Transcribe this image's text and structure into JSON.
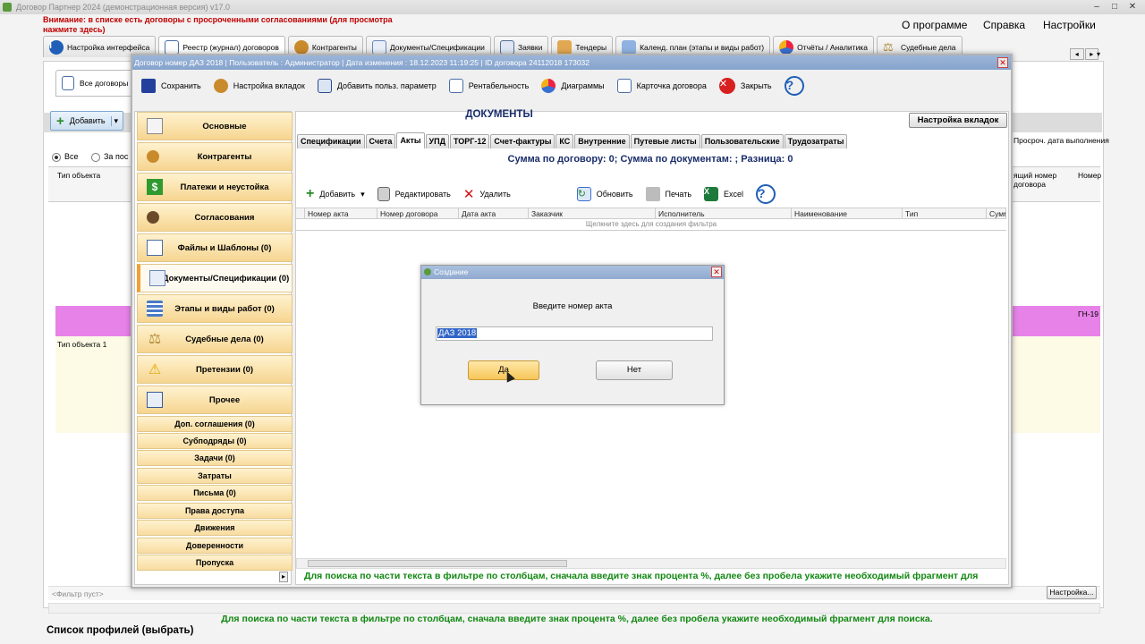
{
  "app": {
    "title": "Договор Партнер 2024 (демонстрационная версия) v17.0",
    "warning": "Внимание: в списке есть договоры с просроченными согласованиями (для просмотра нажмите здесь)",
    "menu": [
      "О программе",
      "Справка",
      "Настройки"
    ]
  },
  "main_tabs": [
    {
      "label": "Настройка интерфейса",
      "icon": "info-icon"
    },
    {
      "label": "Реестр (журнал) договоров",
      "icon": "document-icon"
    },
    {
      "label": "Контрагенты",
      "icon": "people-icon"
    },
    {
      "label": "Документы/Спецификации",
      "icon": "documents-icon"
    },
    {
      "label": "Заявки",
      "icon": "list-icon"
    },
    {
      "label": "Тендеры",
      "icon": "handshake-icon"
    },
    {
      "label": "Календ. план (этапы и виды работ)",
      "icon": "calendar-icon"
    },
    {
      "label": "Отчёты / Аналитика",
      "icon": "pie-chart-icon"
    },
    {
      "label": "Судебные дела",
      "icon": "scales-icon"
    }
  ],
  "background": {
    "subtab_label": "Все договоры",
    "add_label": "Добавить",
    "radio_all": "Все",
    "radio_period": "За пос",
    "col_type": "Тип объекта",
    "col_overdue": "Просроч. дата выполнения",
    "col_num_a": "ящий номер договора",
    "col_num_b": "Номер",
    "pink_cell": "ГН-19",
    "yellow_cell": "Тип объекта 1",
    "filter_empty": "<Фильтр пуст>",
    "settings_btn": "Настройка...",
    "hint": "Для поиска по части текста в фильтре по столбцам, сначала введите знак процента %, далее без пробела укажите необходимый фрагмент для поиска.",
    "profile": "Список профилей (выбрать)"
  },
  "contract_window": {
    "title": "Договор номер ДАЗ 2018 | Пользователь : Администратор | Дата изменения : 18.12.2023 11:19:25 | ID договора 24112018 173032",
    "toolbar": [
      {
        "label": "Сохранить",
        "icon": "save-icon"
      },
      {
        "label": "Настройка вкладок",
        "icon": "settings-people-icon"
      },
      {
        "label": "Добавить польз. параметр",
        "icon": "table-icon"
      },
      {
        "label": "Рентабельность",
        "icon": "document-icon"
      },
      {
        "label": "Диаграммы",
        "icon": "pie-chart-icon"
      },
      {
        "label": "Карточка договора",
        "icon": "card-icon"
      },
      {
        "label": "Закрыть",
        "icon": "close-icon"
      }
    ],
    "nav": [
      "Основные",
      "Контрагенты",
      "Платежи и неустойка",
      "Согласования",
      "Файлы и Шаблоны (0)",
      "Документы/Спецификации (0)",
      "Этапы и виды работ (0)",
      "Судебные дела (0)",
      "Претензии (0)",
      "Прочее"
    ],
    "nav_small": [
      "Доп. соглашения (0)",
      "Субподряды (0)",
      "Задачи (0)",
      "Затраты",
      "Письма (0)",
      "Права доступа",
      "Движения",
      "Доверенности",
      "Пропуска"
    ],
    "docs_title": "ДОКУМЕНТЫ",
    "tab_settings": "Настройка вкладок",
    "doc_tabs": [
      "Спецификации",
      "Счета",
      "Акты",
      "УПД",
      "ТОРГ-12",
      "Счет-фактуры",
      "КС",
      "Внутренние",
      "Путевые листы",
      "Пользовательские",
      "Трудозатраты"
    ],
    "active_doc_tab": "Акты",
    "sum_line": "Сумма по договору: 0; Сумма по документам: ; Разница: 0",
    "doc_toolbar": [
      {
        "label": "Добавить",
        "icon": "plus-icon"
      },
      {
        "label": "Редактировать",
        "icon": "edit-icon"
      },
      {
        "label": "Удалить",
        "icon": "delete-icon"
      },
      {
        "label": "Обновить",
        "icon": "refresh-icon"
      },
      {
        "label": "Печать",
        "icon": "print-icon"
      },
      {
        "label": "Excel",
        "icon": "excel-icon"
      }
    ],
    "grid_columns": [
      "Номер акта",
      "Номер договора",
      "Дата акта",
      "Заказчик",
      "Исполнитель",
      "Наименование",
      "Тип",
      "Сумма"
    ],
    "grid_filter_hint": "Щелкните здесь для создания фильтра",
    "hint": "Для поиска по части текста в фильтре по столбцам, сначала введите знак процента %, далее без пробела укажите необходимый фрагмент для"
  },
  "dialog": {
    "title": "Создание",
    "prompt": "Введите номер акта",
    "value": "ДАЗ 2018",
    "yes": "Да",
    "no": "Нет"
  },
  "colors": {
    "accent_orange": "#f6d590",
    "highlight_pink": "#e783e8",
    "hint_green": "#118811",
    "warning_red": "#c00000"
  }
}
